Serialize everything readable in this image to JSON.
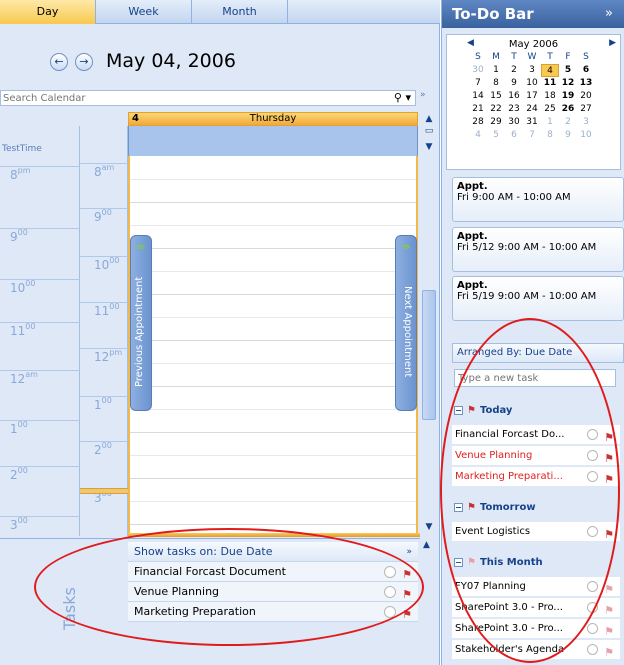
{
  "view_tabs": [
    "Day",
    "Week",
    "Month"
  ],
  "date_title": "May 04, 2006",
  "search": {
    "placeholder": "Search Calendar"
  },
  "timezone_label": "TestTime",
  "times_left": [
    {
      "h": "8",
      "s": "pm"
    },
    {
      "h": "9",
      "s": "00"
    },
    {
      "h": "10",
      "s": "00"
    },
    {
      "h": "11",
      "s": "00"
    },
    {
      "h": "12",
      "s": "am"
    },
    {
      "h": "1",
      "s": "00"
    },
    {
      "h": "2",
      "s": "00"
    },
    {
      "h": "3",
      "s": "00"
    }
  ],
  "times_right": [
    {
      "h": "8",
      "s": "am"
    },
    {
      "h": "9",
      "s": "00"
    },
    {
      "h": "10",
      "s": "00"
    },
    {
      "h": "11",
      "s": "00"
    },
    {
      "h": "12",
      "s": "pm"
    },
    {
      "h": "1",
      "s": "00"
    },
    {
      "h": "2",
      "s": "00"
    },
    {
      "h": "3",
      "s": "00"
    }
  ],
  "day_header": {
    "number": "4",
    "name": "Thursday"
  },
  "prev_appointment": "Previous Appointment",
  "next_appointment": "Next Appointment",
  "tasks_panel": {
    "label": "Tasks",
    "show_tasks_on": "Show tasks on: Due Date",
    "items": [
      "Financial Forcast Document",
      "Venue Planning",
      "Marketing Preparation"
    ]
  },
  "todo_bar": {
    "title": "To-Do Bar",
    "expand": "»",
    "calendar": {
      "month": "May 2006",
      "weekdays": [
        "S",
        "M",
        "T",
        "W",
        "T",
        "F",
        "S"
      ],
      "weeks": [
        [
          "30",
          "1",
          "2",
          "3",
          "4",
          "5",
          "6"
        ],
        [
          "7",
          "8",
          "9",
          "10",
          "11",
          "12",
          "13"
        ],
        [
          "14",
          "15",
          "16",
          "17",
          "18",
          "19",
          "20"
        ],
        [
          "21",
          "22",
          "23",
          "24",
          "25",
          "26",
          "27"
        ],
        [
          "28",
          "29",
          "30",
          "31",
          "1",
          "2",
          "3"
        ],
        [
          "4",
          "5",
          "6",
          "7",
          "8",
          "9",
          "10"
        ]
      ]
    },
    "appointments": [
      {
        "title": "Appt.",
        "time": "Fri 9:00 AM - 10:00 AM"
      },
      {
        "title": "Appt.",
        "time": "Fri 5/12 9:00 AM - 10:00 AM"
      },
      {
        "title": "Appt.",
        "time": "Fri 5/19 9:00 AM - 10:00 AM"
      }
    ],
    "arranged_by": "Arranged By: Due Date",
    "new_task_placeholder": "Type a new task",
    "groups": {
      "today": "Today",
      "tomorrow": "Tomorrow",
      "this_month": "This Month"
    },
    "today_tasks": [
      "Financial Forcast Do...",
      "Venue Planning",
      "Marketing Preparati..."
    ],
    "tomorrow_tasks": [
      "Event Logistics"
    ],
    "month_tasks": [
      "FY07 Planning",
      "SharePoint 3.0 - Pro...",
      "SharePoint 3.0 - Pro...",
      "Stakeholder's Agenda"
    ]
  },
  "colors": {
    "accent": "#f9c84e",
    "header_blue": "#39629f",
    "annotation": "#e01b1b",
    "overdue_red": "#e02020"
  }
}
